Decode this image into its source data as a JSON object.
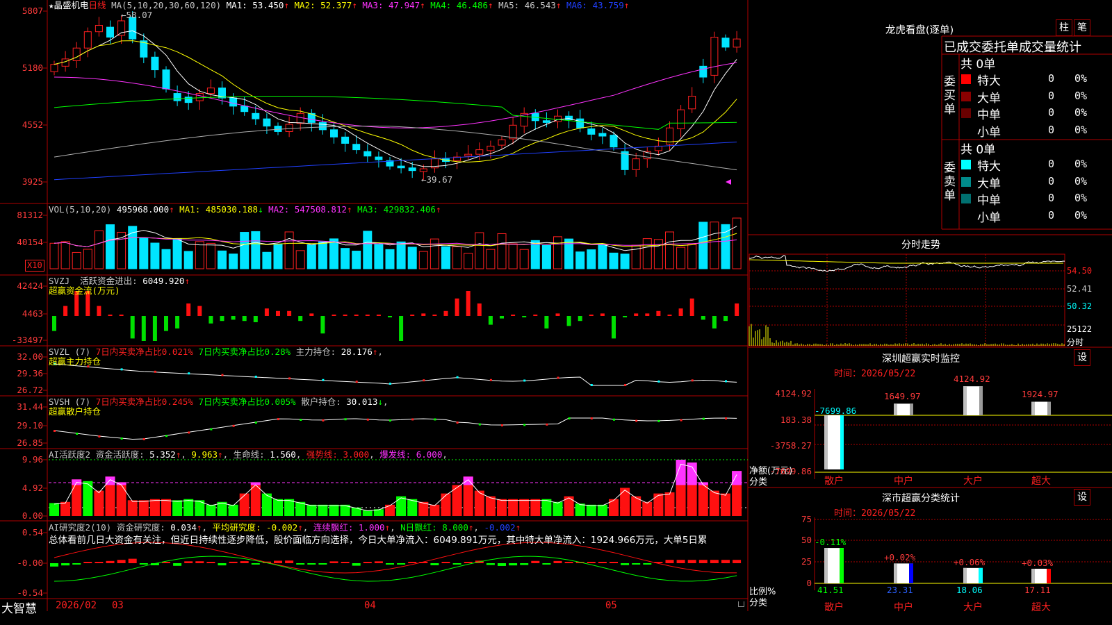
{
  "colors": {
    "up": "#ff2020",
    "down": "#00e5ff",
    "grid": "#b00000",
    "bg": "#000000",
    "green": "#00ff00",
    "magenta": "#ff33ff",
    "yellow": "#ffff00",
    "white": "#ffffff"
  },
  "main_chart": {
    "stock_name": "★晶盛机电",
    "period": "日线",
    "ma_label": "MA(5,10,20,30,60,120)",
    "ma_values": [
      {
        "name": "MA1:",
        "value": "53.450",
        "arrow": "↑",
        "color": "#ffffff"
      },
      {
        "name": "MA2:",
        "value": "52.377",
        "arrow": "↑",
        "color": "#ffff00"
      },
      {
        "name": "MA3:",
        "value": "47.947",
        "arrow": "↑",
        "color": "#ff33ff"
      },
      {
        "name": "MA4:",
        "value": "46.486",
        "arrow": "↑",
        "color": "#00ff00"
      },
      {
        "name": "MA5:",
        "value": "46.543",
        "arrow": "↑",
        "color": "#c8c8c8"
      },
      {
        "name": "MA6:",
        "value": "43.759",
        "arrow": "↑",
        "color": "#2040ff"
      }
    ],
    "y_labels": [
      "5807",
      "5180",
      "4552",
      "3925"
    ],
    "high_marker": "58.07",
    "low_marker": "←39.67"
  },
  "vol_panel": {
    "label": "VOL(5,10,20)",
    "value": "495968.000",
    "ma": [
      {
        "name": "MA1:",
        "value": "485030.188",
        "arrow": "↓",
        "color": "#ffff00"
      },
      {
        "name": "MA2:",
        "value": "547508.812",
        "arrow": "↑",
        "color": "#ff33ff"
      },
      {
        "name": "MA3:",
        "value": "429832.406",
        "arrow": "↑",
        "color": "#00ff00"
      }
    ],
    "y_labels": [
      "81312",
      "40154"
    ],
    "unit": "X10"
  },
  "svzj_panel": {
    "label": "SVZJ",
    "line1_name": "活跃资金进出:",
    "line1_value": "6049.920",
    "line2": "超赢资金流(万元)",
    "y_labels": [
      "42424",
      "4463",
      "-33497"
    ]
  },
  "svzl_panel": {
    "label": "SVZL (7)",
    "t1": "7日内买卖净占比0.021%",
    "t2": "7日内买卖净占比0.28%",
    "t3": "主力持仓:",
    "t3v": "28.176",
    "line2": "超赢主力持仓",
    "y_labels": [
      "32.00",
      "29.36",
      "26.72"
    ]
  },
  "svsh_panel": {
    "label": "SVSH (7)",
    "t1": "7日内买卖净占比0.245%",
    "t2": "7日内买卖净占比0.005%",
    "t3": "散户持仓:",
    "t3v": "30.013",
    "line2": "超赢散户持仓",
    "y_labels": [
      "31.44",
      "29.10",
      "26.85"
    ]
  },
  "ai_active_panel": {
    "label": "AI活跃度2",
    "t1": "资金活跃度:",
    "t1v": "5.352",
    "t2v": "9.963",
    "t3": "生命线:",
    "t3v": "1.560",
    "t4": "强势线:",
    "t4v": "3.000",
    "t5": "爆发线:",
    "t5v": "6.000",
    "y_labels": [
      "9.96",
      "4.92",
      "0.00"
    ]
  },
  "ai_research_panel": {
    "label": "AI研究度2(10)",
    "t1": "资金研究度:",
    "t1v": "0.034",
    "t2": "平均研究度:",
    "t2v": "-0.002",
    "t3": "连续飘红:",
    "t3v": "1.000",
    "t4": "N日飘红:",
    "t4v": "8.000",
    "t5v": "-0.002",
    "comment": "总体看前几日大资金有关注，但近日持续性逐步降低，股价面临方向选择，今日大单净流入：6049.891万元，其中特大单净流入：1924.966万元，大单5日累",
    "y_labels": [
      "0.54",
      "-0.00",
      "-0.54"
    ]
  },
  "bottom_bar": {
    "brand": "大智慧",
    "dates": [
      "2026/02",
      "03",
      "04",
      "05"
    ]
  },
  "dragon_tiger": {
    "title": "龙虎看盘(逐单)",
    "btn1": "柱",
    "btn2": "笔",
    "subtitle": "已成交委托单成交量统计",
    "buy_side": "委买单",
    "sell_side": "委卖单",
    "buy_total": "共 0单",
    "sell_total": "共 0单",
    "buy_rows": [
      {
        "label": "特大",
        "count": "0",
        "pct": "0%",
        "color": "#ff0000"
      },
      {
        "label": "大单",
        "count": "0",
        "pct": "0%",
        "color": "#8b0000"
      },
      {
        "label": "中单",
        "count": "0",
        "pct": "0%",
        "color": "#6a0000"
      },
      {
        "label": "小单",
        "count": "0",
        "pct": "0%",
        "color": ""
      }
    ],
    "sell_rows": [
      {
        "label": "特大",
        "count": "0",
        "pct": "0%",
        "color": "#00ffff"
      },
      {
        "label": "大单",
        "count": "0",
        "pct": "0%",
        "color": "#008b8b"
      },
      {
        "label": "中单",
        "count": "0",
        "pct": "0%",
        "color": "#007070"
      },
      {
        "label": "小单",
        "count": "0",
        "pct": "0%",
        "color": ""
      }
    ]
  },
  "intraday": {
    "title": "分时走势",
    "y_labels": [
      "54.50",
      "52.41",
      "50.32",
      "25122"
    ],
    "time_label": "分时"
  },
  "sz_monitor": {
    "title": "深圳超赢实时监控",
    "btn": "设",
    "time_label": "时间：",
    "time_value": "2026/05/22",
    "y_labels": [
      "4124.92",
      "183.38",
      "-3758.27",
      "-7699.86"
    ],
    "unit_label": "净额(万元)",
    "cat_label": "分类",
    "bars": [
      {
        "cat": "散户",
        "value": -7699.86,
        "label": "-7699.86"
      },
      {
        "cat": "中户",
        "value": 1649.97,
        "label": "1649.97"
      },
      {
        "cat": "大户",
        "value": 4124.92,
        "label": "4124.92"
      },
      {
        "cat": "超大",
        "value": 1924.97,
        "label": "1924.97"
      }
    ]
  },
  "sz_classify": {
    "title": "深市超赢分类统计",
    "btn": "设",
    "time_label": "时间：",
    "time_value": "2026/05/22",
    "y_labels": [
      "75",
      "50",
      "25",
      "0"
    ],
    "ratio_label": "比例%",
    "cat_label": "分类",
    "bars": [
      {
        "cat": "散户",
        "value": 41.51,
        "label": "41.51",
        "delta": "-0.11%",
        "color": "#00ff00"
      },
      {
        "cat": "中户",
        "value": 23.31,
        "label": "23.31",
        "delta": "+0.02%",
        "color": "#0000ff"
      },
      {
        "cat": "大户",
        "value": 18.06,
        "label": "18.06",
        "delta": "+0.06%",
        "color": "#00ffff"
      },
      {
        "cat": "超大",
        "value": 17.11,
        "label": "17.11",
        "delta": "+0.03%",
        "color": "#ff0000"
      }
    ]
  }
}
